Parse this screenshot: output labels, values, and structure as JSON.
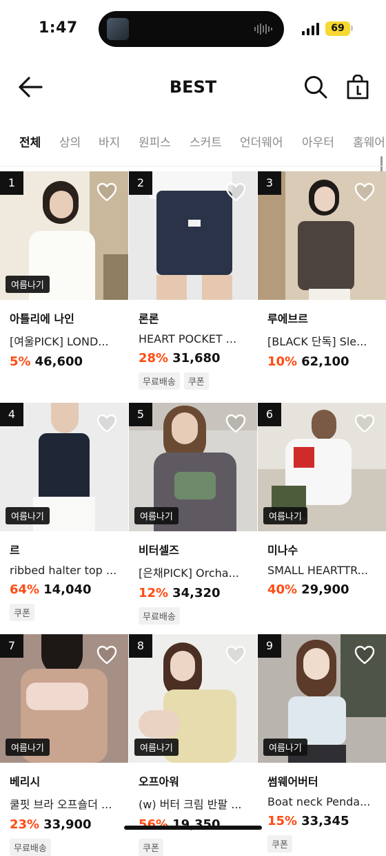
{
  "status": {
    "time": "1:47",
    "battery": "69"
  },
  "header": {
    "title": "BEST"
  },
  "tabs": [
    "전체",
    "상의",
    "바지",
    "원피스",
    "스커트",
    "언더웨어",
    "아우터",
    "홈웨어"
  ],
  "products": [
    {
      "rank": "1",
      "badge": "여름나기",
      "brand": "아틀리에 나인",
      "name": "[여울PICK] LOND...",
      "discount": "5%",
      "price": "46,600",
      "tags": []
    },
    {
      "rank": "2",
      "badge": "",
      "brand": "론론",
      "name": "HEART POCKET ...",
      "discount": "28%",
      "price": "31,680",
      "tags": [
        "무료배송",
        "쿠폰"
      ]
    },
    {
      "rank": "3",
      "badge": "",
      "brand": "루에브르",
      "name": "[BLACK 단독] Sle...",
      "discount": "10%",
      "price": "62,100",
      "tags": []
    },
    {
      "rank": "4",
      "badge": "여름나기",
      "brand": "르",
      "name": "ribbed halter top ...",
      "discount": "64%",
      "price": "14,040",
      "tags": [
        "쿠폰"
      ]
    },
    {
      "rank": "5",
      "badge": "여름나기",
      "brand": "비터셀즈",
      "name": "[은채PICK] Orcha...",
      "discount": "12%",
      "price": "34,320",
      "tags": [
        "무료배송"
      ]
    },
    {
      "rank": "6",
      "badge": "여름나기",
      "brand": "미나수",
      "name": "SMALL HEARTTR...",
      "discount": "40%",
      "price": "29,900",
      "tags": []
    },
    {
      "rank": "7",
      "badge": "여름나기",
      "brand": "베리시",
      "name": "쿨핏 브라 오프숄더 ...",
      "discount": "23%",
      "price": "33,900",
      "tags": [
        "무료배송"
      ]
    },
    {
      "rank": "8",
      "badge": "여름나기",
      "brand": "오프아워",
      "name": "(w) 버터 크림 반팔 ...",
      "discount": "56%",
      "price": "19,350",
      "tags": [
        "쿠폰"
      ]
    },
    {
      "rank": "9",
      "badge": "여름나기",
      "brand": "썸웨어버터",
      "name": "Boat neck Penda...",
      "discount": "15%",
      "price": "33,345",
      "tags": [
        "쿠폰"
      ]
    }
  ],
  "colors": {
    "discount": "#ff4b12",
    "badge_bg": "#111111",
    "battery": "#f7d830"
  }
}
